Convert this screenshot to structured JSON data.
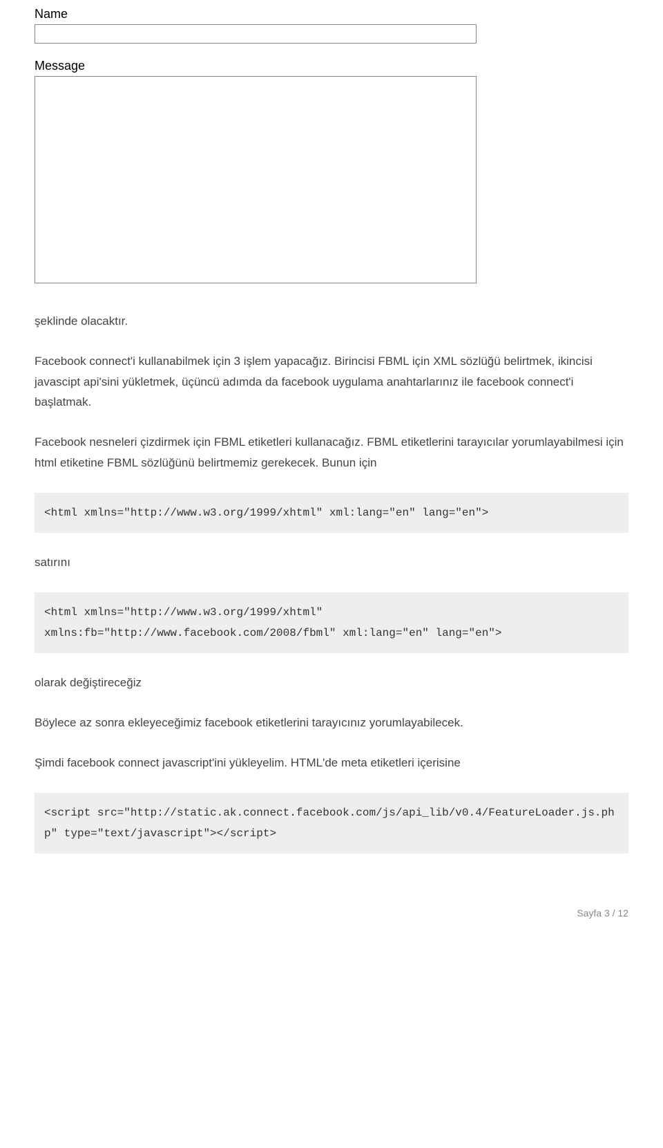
{
  "form": {
    "name_label": "Name",
    "message_label": "Message"
  },
  "paragraphs": {
    "p1": "şeklinde olacaktır.",
    "p2": "Facebook connect'i kullanabilmek için 3 işlem yapacağız. Birincisi FBML için XML sözlüğü belirtmek, ikincisi javascipt api'sini yükletmek, üçüncü adımda da facebook uygulama anahtarlarınız ile facebook connect'i başlatmak.",
    "p3": "Facebook nesneleri çizdirmek için FBML etiketleri kullanacağız. FBML etiketlerini tarayıcılar yorumlayabilmesi için html etiketine FBML sözlüğünü belirtmemiz gerekecek. Bunun için",
    "p4": "satırını",
    "p5": "olarak değiştireceğiz",
    "p6": "Böylece az sonra ekleyeceğimiz facebook etiketlerini tarayıcınız yorumlayabilecek.",
    "p7": "Şimdi facebook connect javascript'ini yükleyelim. HTML'de meta etiketleri içerisine"
  },
  "code": {
    "c1": "<html xmlns=\"http://www.w3.org/1999/xhtml\" xml:lang=\"en\" lang=\"en\">",
    "c2": "<html xmlns=\"http://www.w3.org/1999/xhtml\"\nxmlns:fb=\"http://www.facebook.com/2008/fbml\" xml:lang=\"en\" lang=\"en\">",
    "c3": "<script src=\"http://static.ak.connect.facebook.com/js/api_lib/v0.4/FeatureLoader.js.php\" type=\"text/javascript\"></script>"
  },
  "footer": {
    "page_label": "Sayfa 3 / 12"
  }
}
